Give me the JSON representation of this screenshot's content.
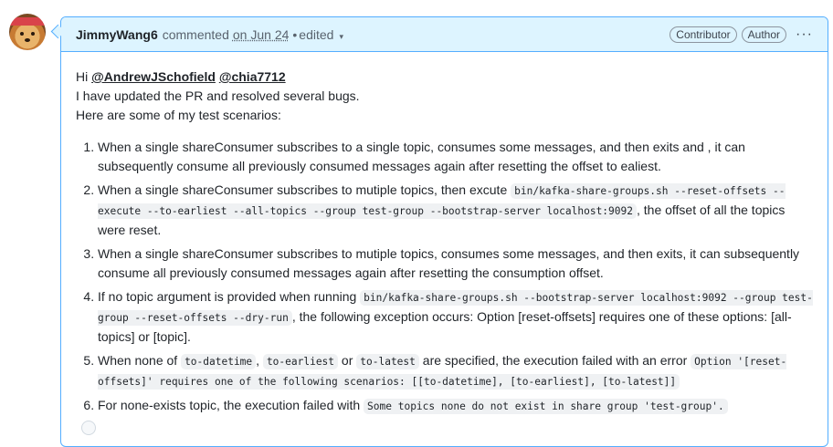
{
  "comment": {
    "author": "JimmyWang6",
    "action": "commented",
    "date": "on Jun 24",
    "edited_sep": "•",
    "edited": "edited",
    "caret": "▾",
    "badges": [
      "Contributor",
      "Author"
    ],
    "more": "···"
  },
  "body": {
    "hi": "Hi",
    "mention1": "@AndrewJSchofield",
    "mention2": "@chia7712",
    "line2": "I have updated the PR and resolved several bugs.",
    "line3": "Here are some of my test scenarios:",
    "items": {
      "i1": "When a single shareConsumer subscribes to a single topic, consumes some messages, and then exits and , it can subsequently consume all previously consumed messages again after resetting the offset to ealiest.",
      "i2a": "When a single shareConsumer subscribes to mutiple topics, then excute",
      "i2code": "bin/kafka-share-groups.sh --reset-offsets --execute --to-earliest --all-topics --group test-group --bootstrap-server localhost:9092",
      "i2b": ", the offset of all the topics were reset.",
      "i3": "When a single shareConsumer subscribes to mutiple topics, consumes some messages, and then exits, it can subsequently consume all previously consumed messages again after resetting the consumption offset.",
      "i4a": "If no topic argument is provided when running",
      "i4code": "bin/kafka-share-groups.sh --bootstrap-server localhost:9092 --group test-group --reset-offsets --dry-run",
      "i4b": ", the following exception occurs: Option [reset-offsets] requires one of these options: [all-topics] or [topic].",
      "i5a": "When none of",
      "i5c1": "to-datetime",
      "i5s1": ",",
      "i5c2": "to-earliest",
      "i5s2": "or",
      "i5c3": "to-latest",
      "i5b": "are specified, the execution failed with an error",
      "i5c4": "Option '[reset-offsets]' requires one of the following scenarios: [[to-datetime], [to-earliest], [to-latest]]",
      "i6a": "For none-exists topic, the execution failed with",
      "i6code": "Some topics none do not exist in share group 'test-group'.",
      "i6b": ""
    }
  }
}
